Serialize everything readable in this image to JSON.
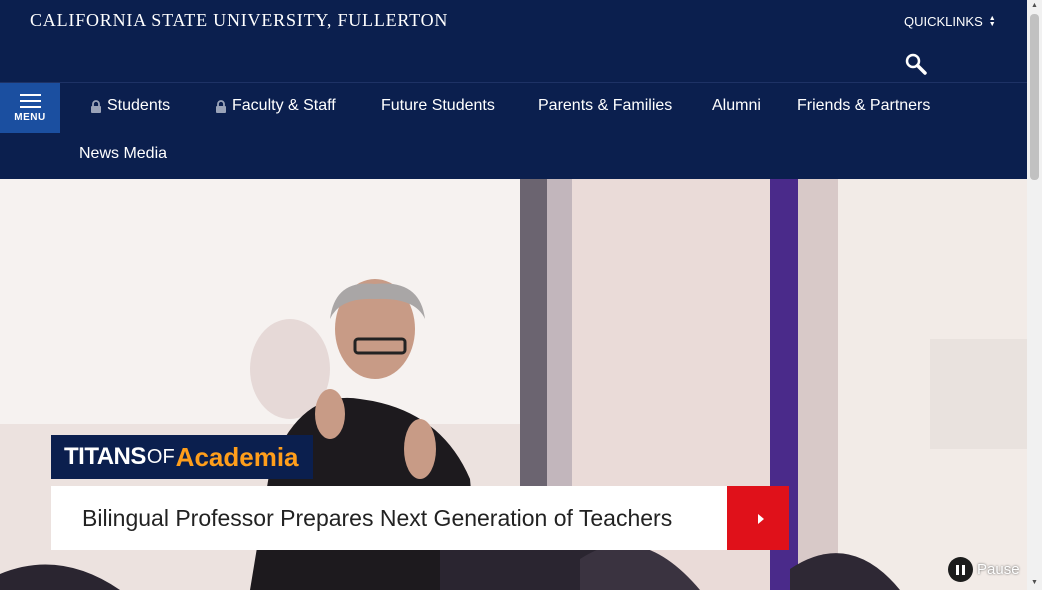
{
  "header": {
    "site_title": "CALIFORNIA STATE UNIVERSITY, FULLERTON",
    "quicklinks_label": "QUICKLINKS",
    "menu_label": "MENU",
    "bg_color": "#0b1f4e",
    "menu_bg_color": "#1b4fa0"
  },
  "nav": {
    "items": [
      {
        "label": "Students",
        "locked": true
      },
      {
        "label": "Faculty & Staff",
        "locked": true
      },
      {
        "label": "Future Students",
        "locked": false
      },
      {
        "label": "Parents & Families",
        "locked": false
      },
      {
        "label": "Alumni",
        "locked": false
      },
      {
        "label": "Friends & Partners",
        "locked": false
      },
      {
        "label": "News Media",
        "locked": false
      }
    ]
  },
  "hero": {
    "badge": {
      "word1": "TITANS",
      "word2": "OF",
      "word3": "Academia"
    },
    "headline": "Bilingual Professor Prepares Next Generation of Teachers",
    "pause_label": "Pause",
    "accent_color": "#e0111a",
    "badge_accent_color": "#ff9e1b"
  }
}
